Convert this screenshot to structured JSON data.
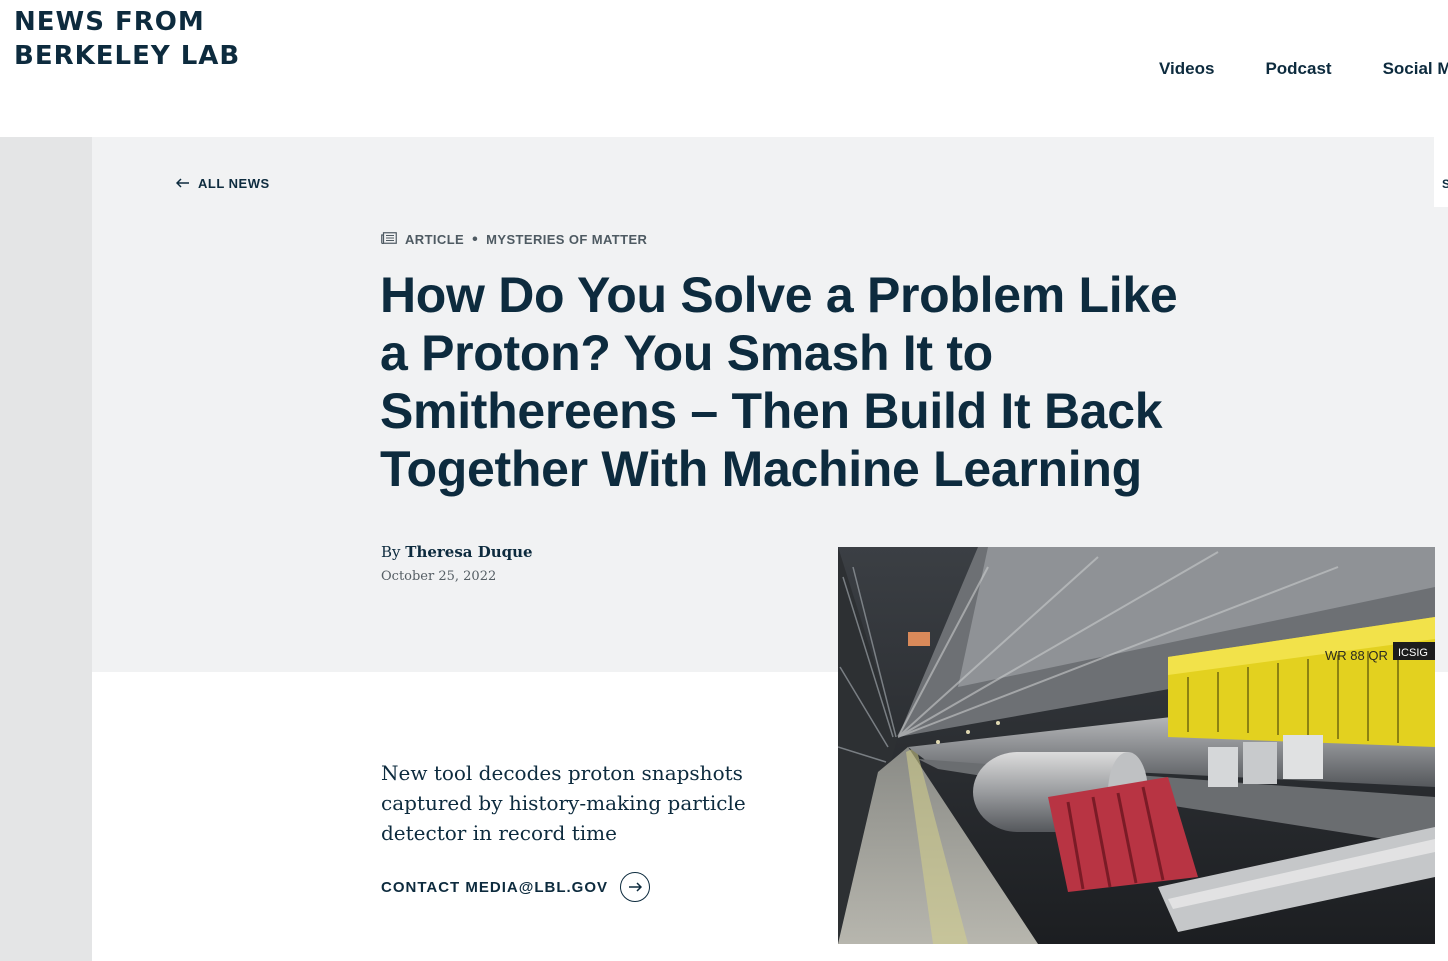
{
  "site": {
    "title": "NEWS FROM BERKELEY LAB",
    "title_line1": "NEWS FROM",
    "title_line2": "BERKELEY LAB"
  },
  "nav": {
    "items": [
      {
        "label": "Videos"
      },
      {
        "label": "Podcast"
      },
      {
        "label": "Social Me"
      }
    ]
  },
  "back_link": {
    "label": "ALL NEWS"
  },
  "right_edge_text": "S",
  "article": {
    "type_label": "ARTICLE",
    "separator": "•",
    "category": "MYSTERIES OF MATTER",
    "title": "How Do You Solve a Problem Like a Proton? You Smash It to Smithereens – Then Build It Back Together With Machine Learning",
    "byline_prefix": "By",
    "author": "Theresa Duque",
    "date": "October 25, 2022",
    "subtitle": "New tool decodes proton snapshots captured by history-making particle detector in record time",
    "contact_label": "CONTACT MEDIA@LBL.GOV",
    "photo_text": {
      "sign_1": "WR 88 QR",
      "sign_2": "ICSIG"
    }
  },
  "colors": {
    "brand": "#0d2b3e",
    "hero_bg": "#f1f2f3",
    "rail_bg": "#e4e5e6"
  },
  "icons": {
    "back": "arrow-left-icon",
    "article": "newspaper-icon",
    "contact": "arrow-right-circle-icon"
  }
}
